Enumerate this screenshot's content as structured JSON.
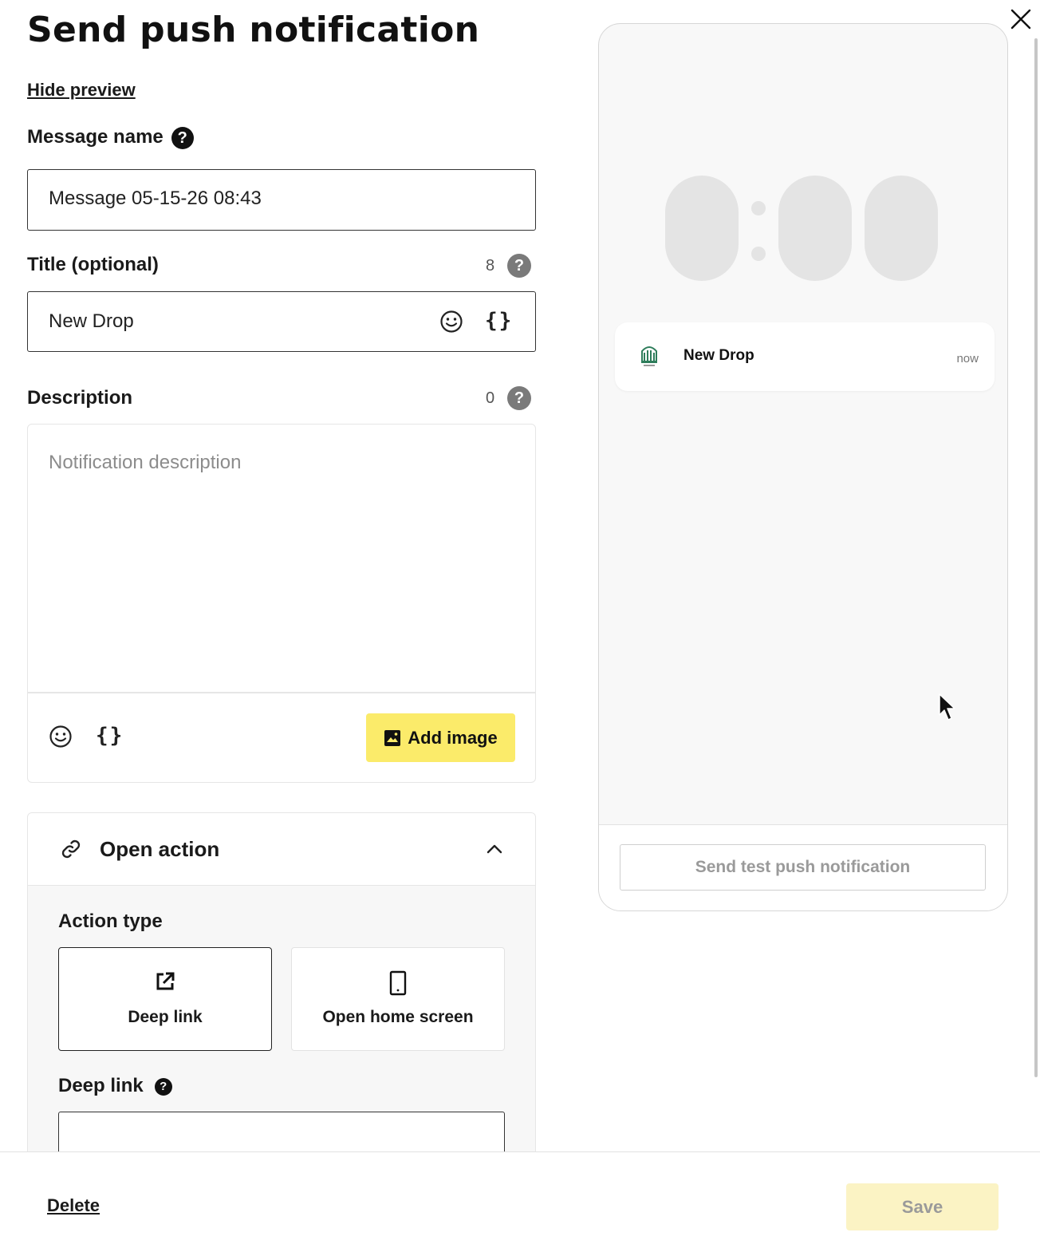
{
  "header": {
    "title": "Send push notification",
    "hide_preview": "Hide preview"
  },
  "message_name": {
    "label": "Message name",
    "help": "?",
    "value": "Message 05-15-26 08:43"
  },
  "title_field": {
    "label": "Title (optional)",
    "count": "8",
    "help": "?",
    "value": "New Drop",
    "braces": "{}"
  },
  "description": {
    "label": "Description",
    "count": "0",
    "help": "?",
    "placeholder": "Notification description",
    "braces": "{}",
    "add_image": "Add image"
  },
  "open_action": {
    "header": "Open action",
    "action_type_label": "Action type",
    "options": [
      {
        "label": "Deep link",
        "icon": "external-link-icon",
        "selected": true
      },
      {
        "label": "Open home screen",
        "icon": "phone-icon",
        "selected": false
      }
    ],
    "deep_link_label": "Deep link",
    "deep_link_help": "?",
    "deep_link_value": ""
  },
  "preview": {
    "notification_title": "New Drop",
    "notification_time": "now",
    "test_button": "Send test push notification"
  },
  "footer": {
    "delete": "Delete",
    "save": "Save"
  },
  "colors": {
    "accent_yellow": "#fbeb6a",
    "disabled_yellow": "#fbf3c4",
    "text": "#1a1a1a",
    "border": "#333333"
  }
}
